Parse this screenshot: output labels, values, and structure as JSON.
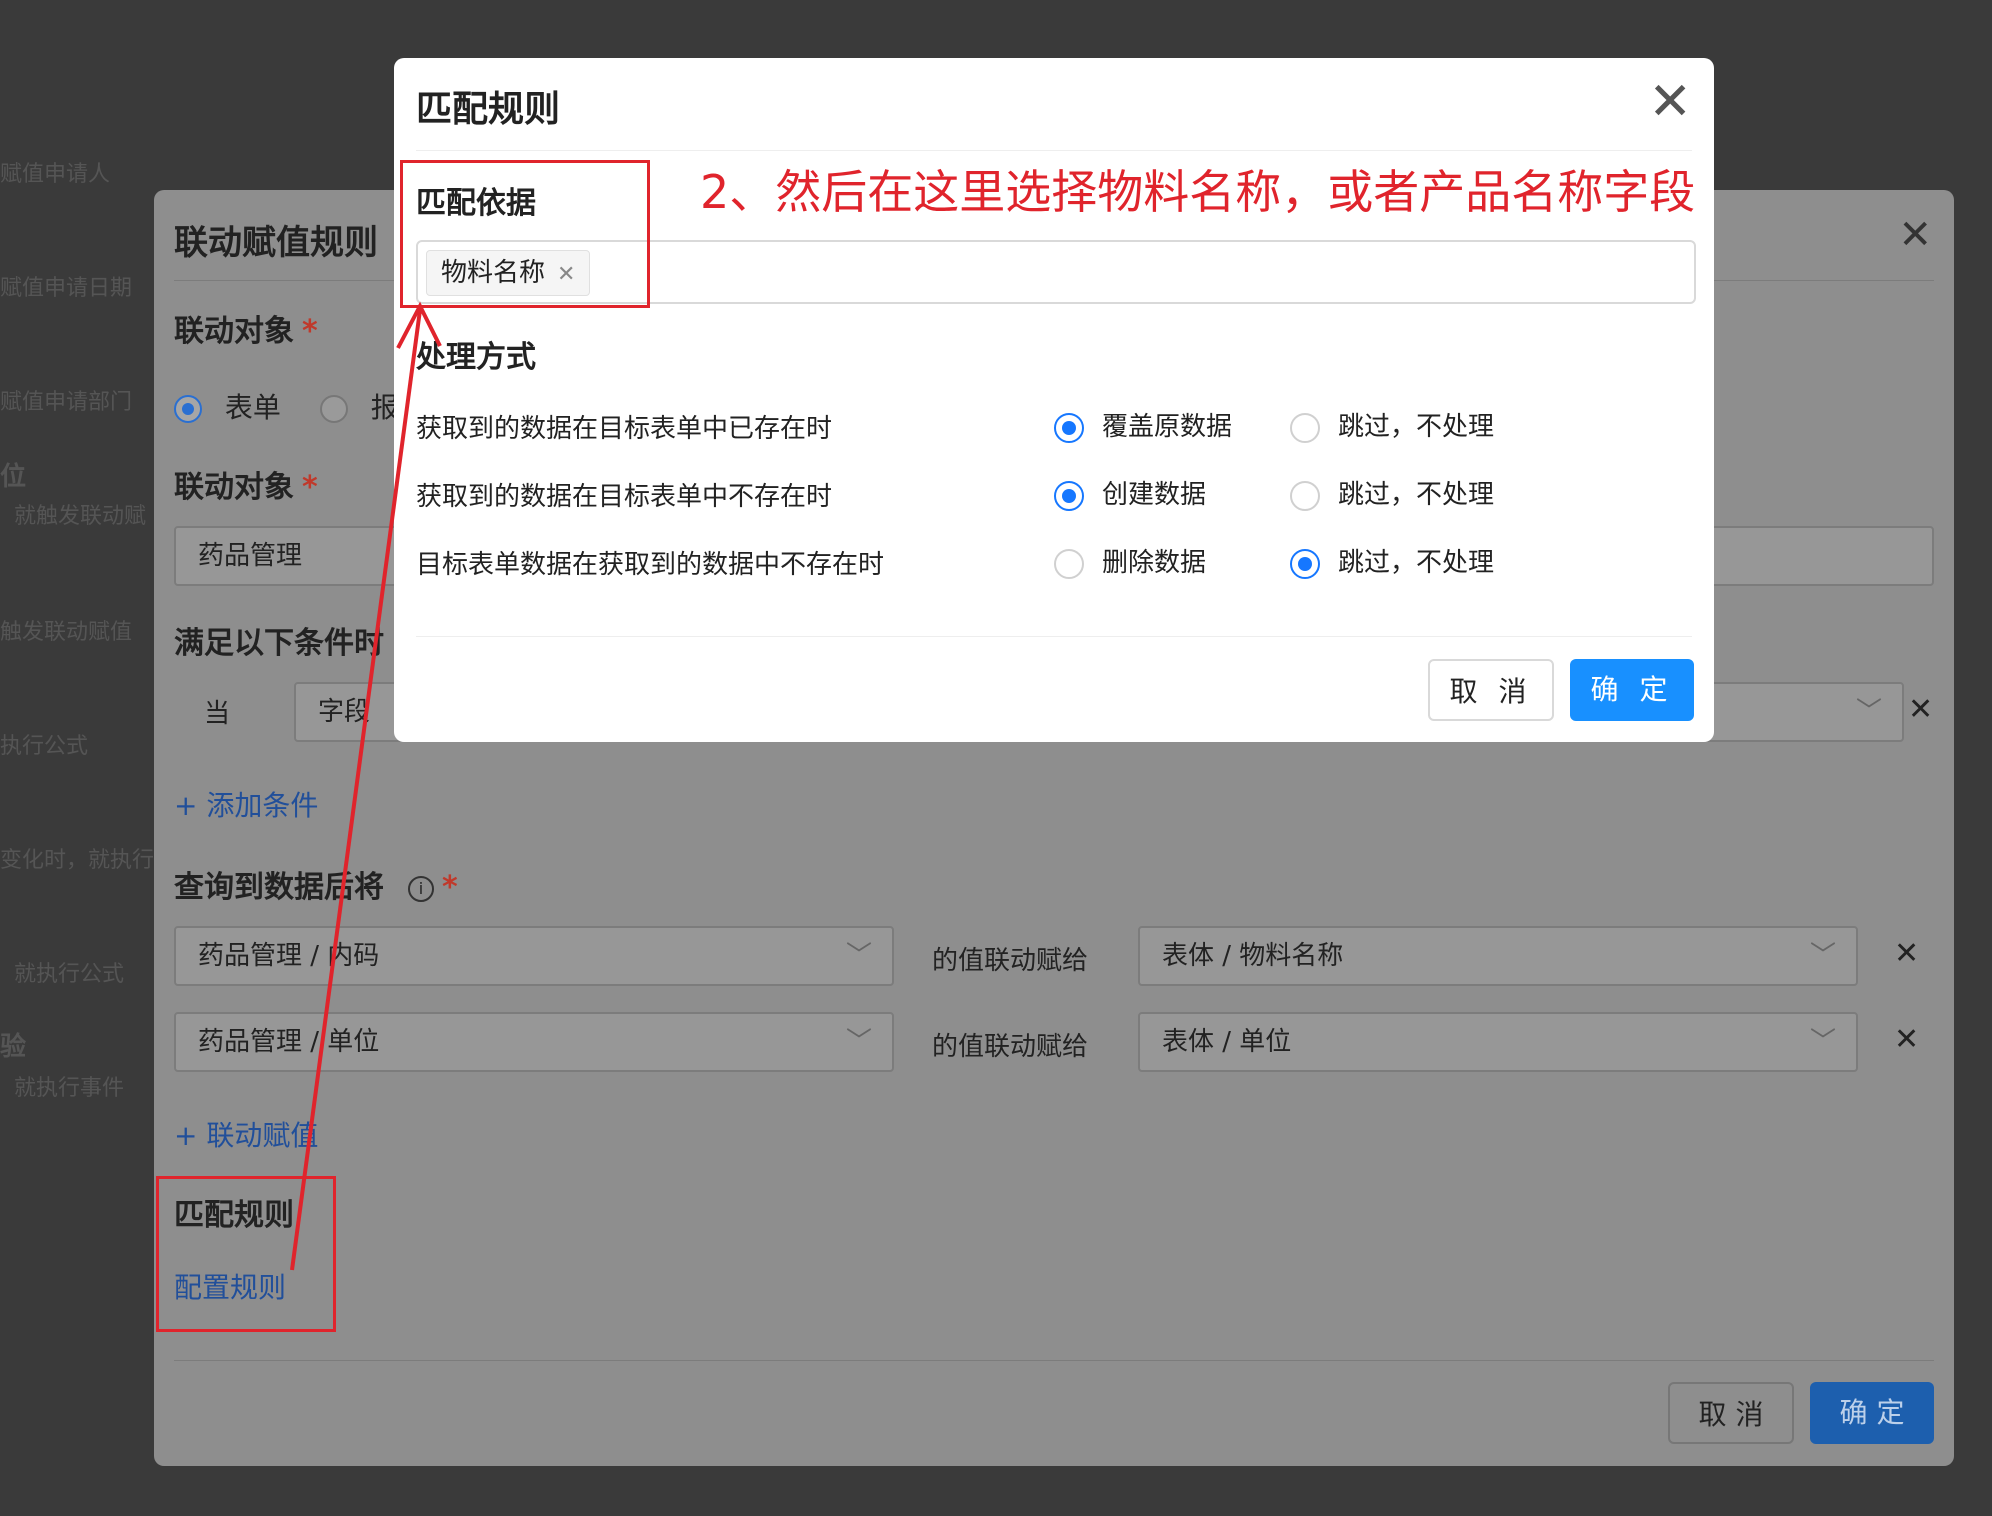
{
  "background": {
    "frags": [
      "赋值申请人",
      "赋值申请日期",
      "赋值申请部门",
      "位",
      "就触发联动赋",
      "触发联动赋值",
      "执行公式",
      "变化时，就执行",
      "就执行公式",
      "验",
      "就执行事件"
    ]
  },
  "back_dialog": {
    "title": "联动赋值规则",
    "target_label_1": "联动对象",
    "radio_form": "表单",
    "radio_report": "报表",
    "target_label_2": "联动对象",
    "target_value": "药品管理",
    "condition_label": "满足以下条件时",
    "cond_when": "当",
    "cond_field": "字段",
    "add_condition": "+ 添加条件",
    "after_query_label": "查询到数据后将",
    "mappings": [
      {
        "source": "药品管理 / 内码",
        "middle": "的值联动赋给",
        "target": "表体 / 物料名称"
      },
      {
        "source": "药品管理 / 单位",
        "middle": "的值联动赋给",
        "target": "表体 / 单位"
      }
    ],
    "add_mapping": "+ 联动赋值",
    "match_rule_label": "匹配规则",
    "config_rule_link": "配置规则",
    "cancel": "取 消",
    "ok": "确 定"
  },
  "modal": {
    "title": "匹配规则",
    "basis_label": "匹配依据",
    "basis_tag": "物料名称",
    "method_label": "处理方式",
    "rows": [
      {
        "label": "获取到的数据在目标表单中已存在时",
        "opt1": "覆盖原数据",
        "opt2": "跳过，不处理",
        "selected": 1
      },
      {
        "label": "获取到的数据在目标表单中不存在时",
        "opt1": "创建数据",
        "opt2": "跳过，不处理",
        "selected": 1
      },
      {
        "label": "目标表单数据在获取到的数据中不存在时",
        "opt1": "删除数据",
        "opt2": "跳过，不处理",
        "selected": 2
      }
    ],
    "cancel": "取 消",
    "ok": "确 定"
  },
  "annotation": {
    "text": "2、然后在这里选择物料名称，或者产品名称字段"
  },
  "colors": {
    "primary": "#1890ff",
    "annotation": "#e0242c"
  }
}
